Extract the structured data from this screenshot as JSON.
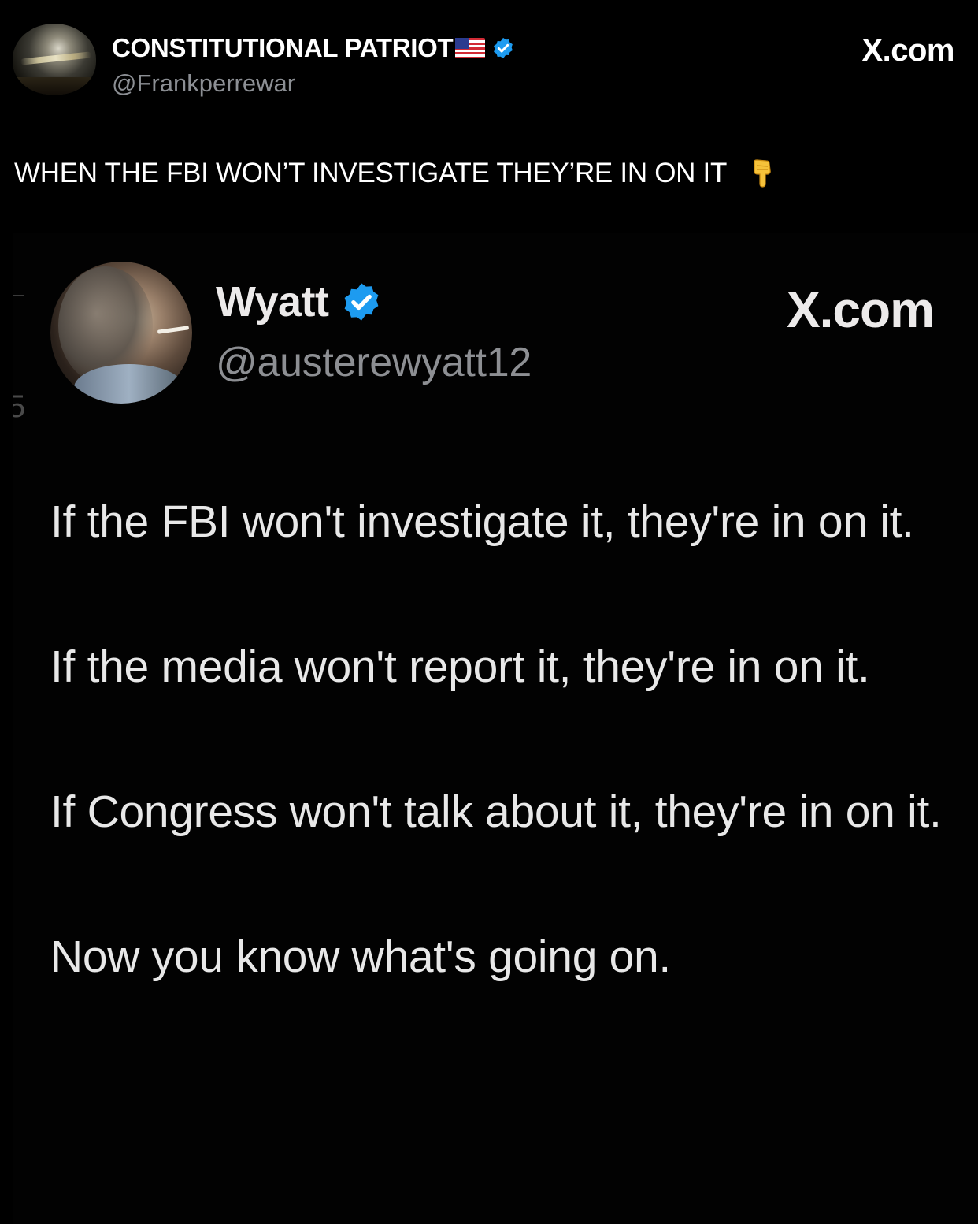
{
  "outer_post": {
    "author_name": "CONSTITUTIONAL PATRIOT",
    "author_handle": "@Frankperrewar",
    "site_label": "X.com",
    "text": "WHEN THE FBI WON’T INVESTIGATE THEY’RE IN ON IT",
    "emoji": "backhand-index-pointing-down",
    "name_flag": "us-flag",
    "verified": true
  },
  "embedded_post": {
    "author_name": "Wyatt",
    "author_handle": "@austerewyatt12",
    "site_label": "X.com",
    "verified": true,
    "paragraphs": [
      "If the FBI won't investigate it, they're in on it.",
      "If the media won't report it, they're in on it.",
      "If Congress won't talk about it, they're in on it.",
      "Now you know what's going on."
    ],
    "edge_glyph": "5"
  },
  "colors": {
    "background": "#000000",
    "text": "#ffffff",
    "handle": "#8c8f94",
    "verified_badge": "#1d9bf0"
  }
}
